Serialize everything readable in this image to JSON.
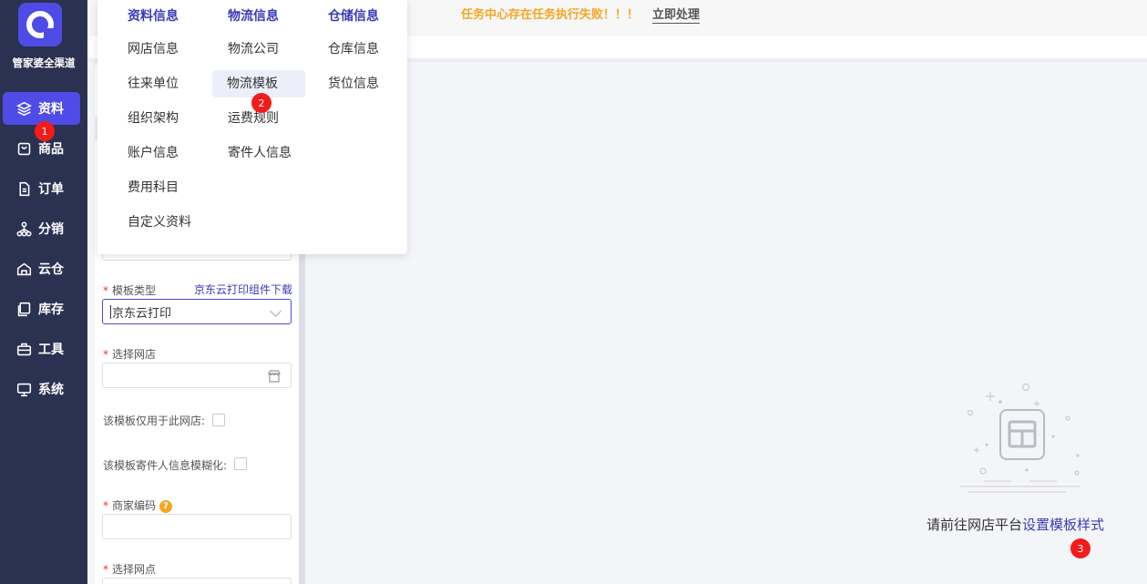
{
  "sidebar": {
    "brand": "管家婆全渠道",
    "items": [
      {
        "label": "资料",
        "icon": "layers-icon"
      },
      {
        "label": "商品",
        "icon": "bag-icon"
      },
      {
        "label": "订单",
        "icon": "document-icon"
      },
      {
        "label": "分销",
        "icon": "network-icon"
      },
      {
        "label": "云仓",
        "icon": "warehouse-icon"
      },
      {
        "label": "库存",
        "icon": "stack-icon"
      },
      {
        "label": "工具",
        "icon": "toolbox-icon"
      },
      {
        "label": "系统",
        "icon": "monitor-icon"
      }
    ]
  },
  "topbar": {
    "warning": "任务中心存在任务执行失败！！！",
    "action": "立即处理"
  },
  "menu": {
    "columns": [
      {
        "heading": "资料信息",
        "items": [
          "网店信息",
          "往来单位",
          "组织架构",
          "账户信息",
          "费用科目",
          "自定义资料"
        ]
      },
      {
        "heading": "物流信息",
        "items": [
          "物流公司",
          "物流模板",
          "运费规则",
          "寄件人信息"
        ]
      },
      {
        "heading": "仓储信息",
        "items": [
          "仓库信息",
          "货位信息"
        ]
      }
    ]
  },
  "form": {
    "template_type_label": "模板类型",
    "download_link": "京东云打印组件下载",
    "template_type_value": "京东云打印",
    "store_label": "选择网店",
    "store_value": "",
    "only_this_store_label": "该模板仅用于此网店:",
    "blur_sender_label": "该模板寄件人信息模糊化:",
    "merchant_code_label": "商家编码",
    "merchant_code_value": "",
    "outlet_label": "选择网点",
    "required_mark": "*",
    "help_mark": "?"
  },
  "empty_state": {
    "text": "请前往网店平台",
    "link": "设置模板样式"
  },
  "badges": [
    "1",
    "2",
    "3"
  ],
  "colors": {
    "sidebar_bg": "#2b3151",
    "accent": "#4f4be6",
    "link": "#3a3ab8",
    "warning": "#f5a623",
    "badge": "#f41b1b"
  }
}
